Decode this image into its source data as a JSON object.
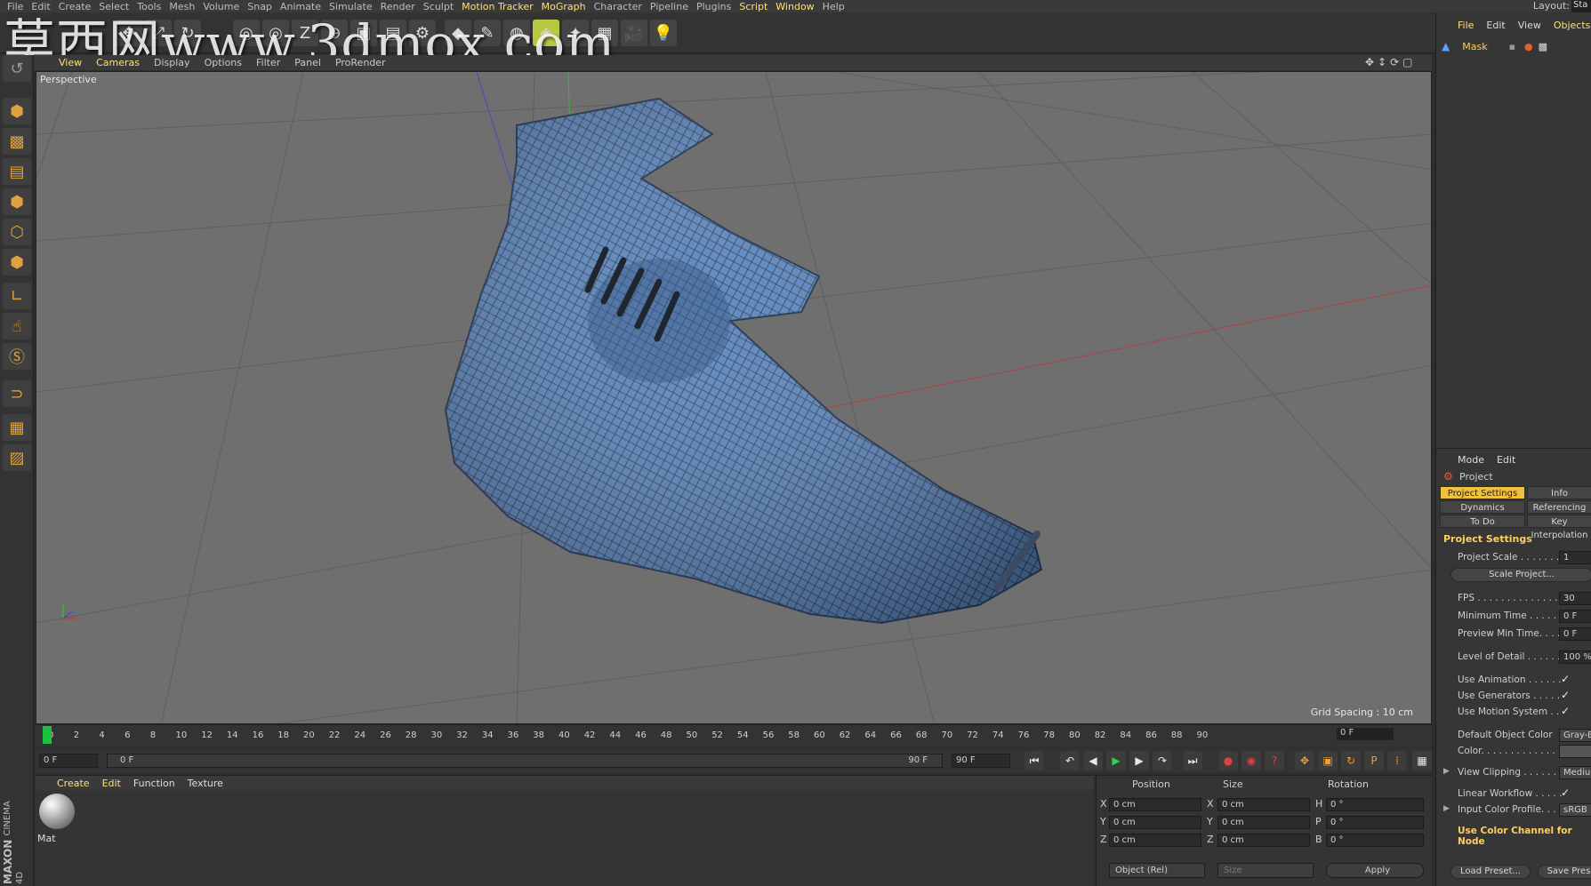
{
  "menubar": {
    "items": [
      "File",
      "Edit",
      "Create",
      "Select",
      "Tools",
      "Mesh",
      "Volume",
      "Snap",
      "Animate",
      "Simulate",
      "Render",
      "Sculpt",
      "Motion Tracker",
      "MoGraph",
      "Character",
      "Pipeline",
      "Plugins",
      "Script",
      "Window",
      "Help"
    ],
    "layout_label": "Layout:",
    "layout_value": "Sta"
  },
  "watermark": "莫西网www.3dmox.com",
  "viewport": {
    "menu": [
      "View",
      "Cameras",
      "Display",
      "Options",
      "Filter",
      "Panel",
      "ProRender"
    ],
    "label": "Perspective",
    "grid_spacing": "Grid Spacing : 10 cm"
  },
  "timeline": {
    "ticks": [
      "0",
      "2",
      "4",
      "6",
      "8",
      "10",
      "12",
      "14",
      "16",
      "18",
      "20",
      "22",
      "24",
      "26",
      "28",
      "30",
      "32",
      "34",
      "36",
      "38",
      "40",
      "42",
      "44",
      "46",
      "48",
      "50",
      "52",
      "54",
      "56",
      "58",
      "60",
      "62",
      "64",
      "66",
      "68",
      "70",
      "72",
      "74",
      "76",
      "78",
      "80",
      "82",
      "84",
      "86",
      "88",
      "90"
    ],
    "current_frame": "0 F",
    "start_field": "0 F",
    "range_start": "0 F",
    "range_end": "90 F",
    "end_field": "90 F"
  },
  "material_manager": {
    "menu": [
      "Create",
      "Edit",
      "Function",
      "Texture"
    ],
    "material_name": "Mat",
    "brand_top": "MAXON",
    "brand_bottom": "CINEMA 4D"
  },
  "coordinates": {
    "headers": [
      "Position",
      "Size",
      "Rotation"
    ],
    "rows": [
      {
        "axis": "X",
        "pos": "0 cm",
        "size_axis": "X",
        "size": "0 cm",
        "rot_axis": "H",
        "rot": "0 °"
      },
      {
        "axis": "Y",
        "pos": "0 cm",
        "size_axis": "Y",
        "size": "0 cm",
        "rot_axis": "P",
        "rot": "0 °"
      },
      {
        "axis": "Z",
        "pos": "0 cm",
        "size_axis": "Z",
        "size": "0 cm",
        "rot_axis": "B",
        "rot": "0 °"
      }
    ],
    "mode_dropdown": "Object (Rel)",
    "size_dropdown": "Size",
    "apply": "Apply"
  },
  "objects_manager": {
    "menu": [
      "File",
      "Edit",
      "View",
      "Objects"
    ],
    "object_name": "Mask"
  },
  "attribute_manager": {
    "menu": [
      "Mode",
      "Edit"
    ],
    "title": "Project",
    "tabs": [
      "Project Settings",
      "Info",
      "Dynamics",
      "Referencing",
      "To Do",
      "Key Interpolation"
    ],
    "section": "Project Settings",
    "rows": [
      {
        "label": "Project Scale . . . . . . .",
        "value": "1"
      },
      {
        "label": "FPS . . . . . . . . . . . . . . .",
        "value": "30"
      },
      {
        "label": "Minimum Time . . . . . .",
        "value": "0 F"
      },
      {
        "label": "Preview Min Time. . . .",
        "value": "0 F"
      },
      {
        "label": "Level of Detail . . . . . .",
        "value": "100 %"
      },
      {
        "label": "Use Animation . . . . . .",
        "value": "✓"
      },
      {
        "label": "Use Generators . . . . .",
        "value": "✓"
      },
      {
        "label": "Use Motion System . .",
        "value": "✓"
      },
      {
        "label": "Default Object Color",
        "value": "Gray-B"
      },
      {
        "label": "Color. . . . . . . . . . . . . .",
        "value": ""
      },
      {
        "label": "View Clipping . . . . . .",
        "value": "Mediu"
      },
      {
        "label": "Linear Workflow . . . . .",
        "value": "✓"
      },
      {
        "label": "Input Color Profile. . .",
        "value": "sRGB"
      }
    ],
    "scale_button": "Scale Project...",
    "node_label": "Use Color Channel for Node",
    "load_preset": "Load Preset...",
    "save_preset": "Save Pres"
  },
  "colors": {
    "accent": "#f0c040",
    "viewport_bg": "#6f6f6f",
    "mesh_blue": "#5a8fd0",
    "playhead": "#1ec040"
  }
}
